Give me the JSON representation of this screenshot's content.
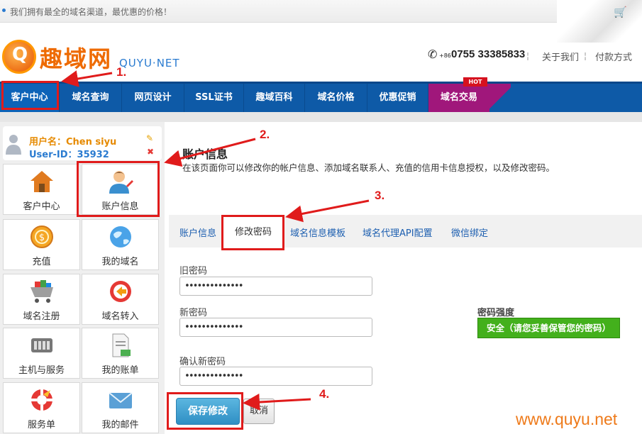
{
  "top": {
    "slogan": "我们拥有最全的域名渠道，最优惠的价格！"
  },
  "brand": {
    "name": "趣域网",
    "sub": "QUYU·NET",
    "logo_letter": "Q"
  },
  "contact": {
    "phone_prefix": "+86",
    "phone": "0755 33385833",
    "links": [
      "关于我们",
      "付款方式"
    ]
  },
  "nav": {
    "items": [
      "客户中心",
      "域名查询",
      "网页设计",
      "SSL证书",
      "趣域百科",
      "域名价格",
      "优惠促销",
      "域名交易"
    ],
    "hot_badge": "HOT"
  },
  "user": {
    "name_label": "用户名：Chen siyu",
    "id_label": "User-ID：35932"
  },
  "sidebar_tiles": [
    "客户中心",
    "账户信息",
    "充值",
    "我的域名",
    "域名注册",
    "域名转入",
    "主机与服务",
    "我的账单",
    "服务单",
    "我的邮件"
  ],
  "main": {
    "title": "账户信息",
    "description": "在该页面你可以修改你的帐户信息、添加域名联系人、充值的信用卡信息授权，以及修改密码。",
    "tabs": [
      "账户信息",
      "修改密码",
      "域名信息模板",
      "域名代理API配置",
      "微信绑定"
    ],
    "active_tab": "修改密码"
  },
  "form": {
    "old_label": "旧密码",
    "old_value": "••••••••••••••",
    "new_label": "新密码",
    "new_value": "••••••••••••••",
    "confirm_label": "确认新密码",
    "confirm_value": "••••••••••••••",
    "strength_label": "密码强度",
    "strength_value": "安全（请您妥善保管您的密码）",
    "save": "保存修改",
    "cancel": "取消"
  },
  "annotations": [
    "1.",
    "2.",
    "3.",
    "4."
  ],
  "watermark": "www.quyu.net",
  "colors": {
    "nav": "#0e5aa7",
    "hot": "#a0177b",
    "accent_orange": "#ee6a00",
    "annotation": "#e01b1b",
    "strength": "#43b01c"
  }
}
